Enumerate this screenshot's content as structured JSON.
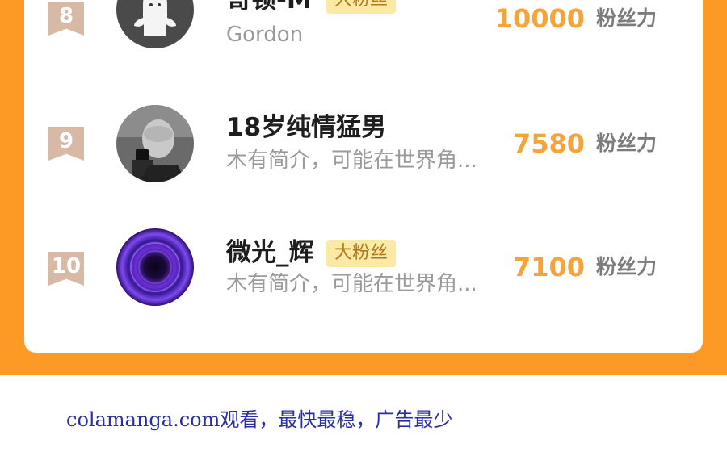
{
  "colors": {
    "orange_background": "#fd9a25",
    "rank_badge": "#d8b9a6",
    "score": "#f5a43a",
    "fan_badge_bg": "#fde9a6",
    "fan_badge_text": "#b07a1b",
    "footer_text": "#2b2fa0"
  },
  "ranking": [
    {
      "rank": "8",
      "name": "哥顿-M",
      "badge": "大粉丝",
      "subtitle": "Gordon",
      "score": "10000",
      "unit": "粉丝力",
      "avatar_icon": "ghost-avatar-icon"
    },
    {
      "rank": "9",
      "name": "18岁纯情猛男",
      "badge": "",
      "subtitle": "木有简介，可能在世界角...",
      "score": "7580",
      "unit": "粉丝力",
      "avatar_icon": "selfie-photo-avatar"
    },
    {
      "rank": "10",
      "name": "微光_辉",
      "badge": "大粉丝",
      "subtitle": "木有简介，可能在世界角...",
      "score": "7100",
      "unit": "粉丝力",
      "avatar_icon": "purple-vortex-avatar"
    }
  ],
  "footer": {
    "text": "colamanga.com观看，最快最稳，广告最少"
  }
}
